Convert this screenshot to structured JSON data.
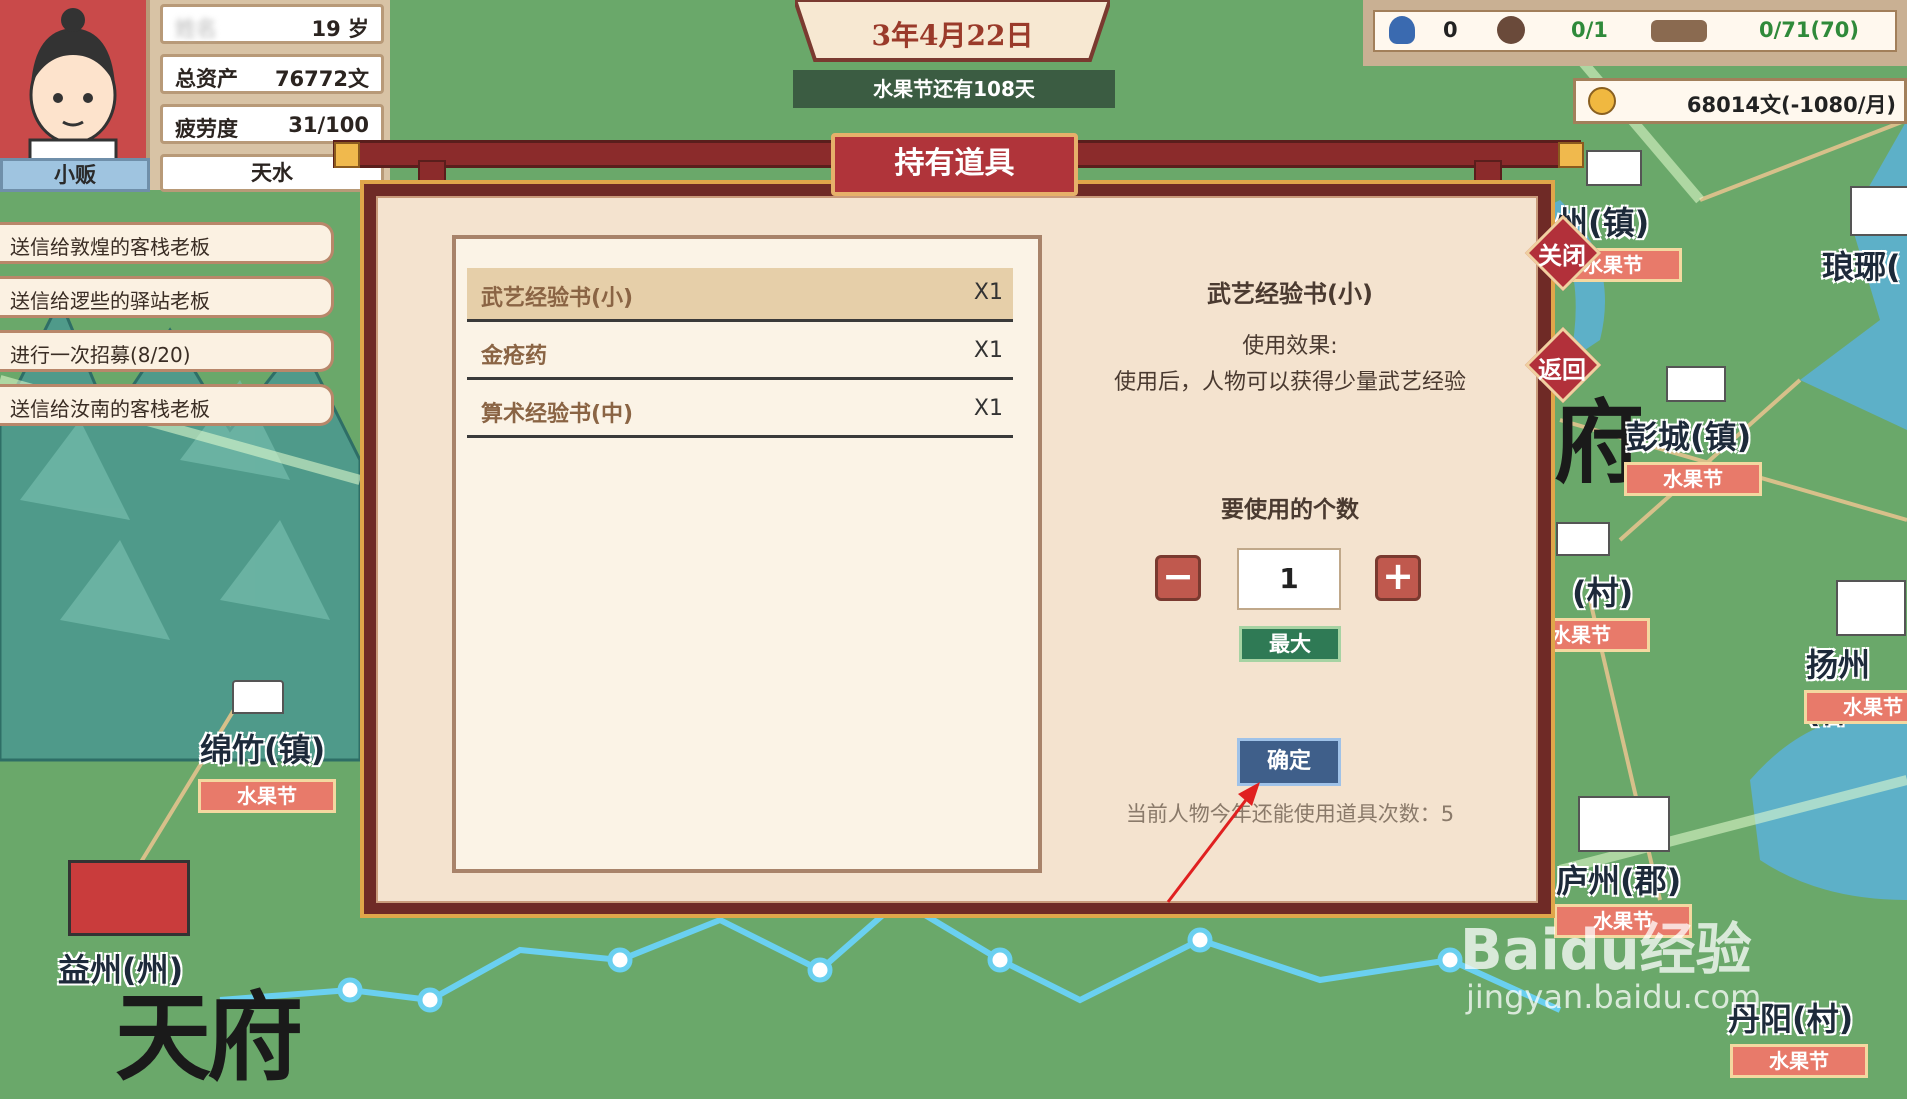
{
  "player": {
    "name_blurred": "姓名",
    "age": "19 岁",
    "assets_label": "总资产",
    "assets_value": "76772文",
    "fatigue_label": "疲劳度",
    "fatigue_value": "31/100",
    "occupation": "小贩",
    "location": "天水"
  },
  "date": {
    "text": "3年4月22日",
    "festival_countdown": "水果节还有108天"
  },
  "resources": {
    "item1_value": "0",
    "item2_value": "0/1",
    "item3_value": "0/71(70)",
    "money": "68014文(-1080/月)"
  },
  "tasks": [
    {
      "label": "送信给敦煌的客栈老板"
    },
    {
      "label": "送信给逻些的驿站老板"
    },
    {
      "label": "进行一次招募(8/20)"
    },
    {
      "label": "送信给汝南的客栈老板"
    }
  ],
  "dialog": {
    "title": "持有道具",
    "close_label": "关闭",
    "back_label": "返回",
    "items": [
      {
        "name": "武艺经验书(小)",
        "qty": "X1"
      },
      {
        "name": "金疮药",
        "qty": "X1"
      },
      {
        "name": "算术经验书(中)",
        "qty": "X1"
      }
    ],
    "detail": {
      "name": "武艺经验书(小)",
      "effect_label": "使用效果:",
      "effect_text": "使用后，人物可以获得少量武艺经验",
      "count_label": "要使用的个数",
      "minus": "−",
      "plus": "+",
      "count_value": "1",
      "max_label": "最大",
      "confirm_label": "确定",
      "remaining_text": "当前人物今年还能使用道具次数：5"
    }
  },
  "map": {
    "big_region_text": "天府",
    "region_fragment": "府",
    "towns": [
      {
        "label": "绵竹(镇)",
        "festival": "水果节"
      },
      {
        "label": "益州(州)"
      },
      {
        "label": "州(镇)",
        "festival": "水果节"
      },
      {
        "label": "琅琊("
      },
      {
        "label": "彭城(镇)",
        "festival": "水果节"
      },
      {
        "label": "(村)",
        "festival": "水果节"
      },
      {
        "label": "扬州(郡",
        "festival": "水果节"
      },
      {
        "label": "庐州(郡)",
        "festival": "水果节"
      },
      {
        "label": "丹阳(村)",
        "festival": "水果节"
      }
    ]
  },
  "watermark": {
    "brand": "Baidu经验",
    "url": "jingyan.baidu.com"
  },
  "colors": {
    "dialog_frame": "#6f2a26",
    "paper": "#f4e3cf",
    "title_red": "#b0343a",
    "confirm_blue": "#3f5f8a",
    "max_green": "#2f7a55",
    "map_green": "#6aa86a"
  }
}
